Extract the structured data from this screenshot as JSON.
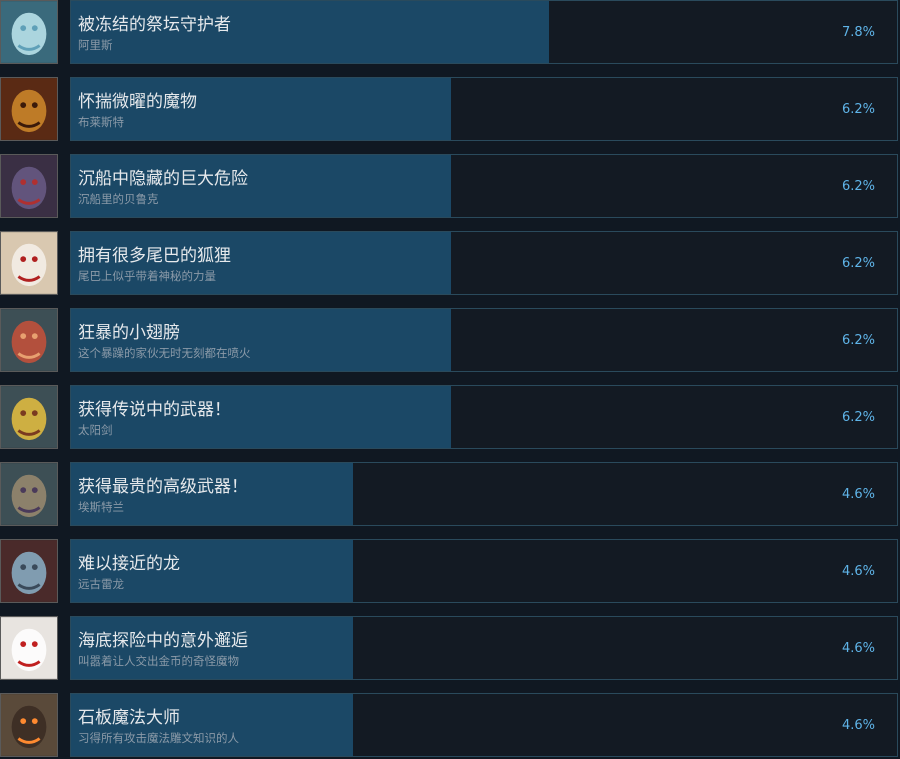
{
  "achievements": [
    {
      "title": "被冻结的祭坛守护者",
      "desc": "阿里斯",
      "percent": "7.8%",
      "fill": 0.078,
      "icon": "ice-golem-icon",
      "icon_bg": "#3a6a7c",
      "icon_fg": "#bfe8f0",
      "icon_accent": "#5fa0b8"
    },
    {
      "title": "怀揣微曜的魔物",
      "desc": "布莱斯特",
      "percent": "6.2%",
      "fill": 0.062,
      "icon": "armored-demon-icon",
      "icon_bg": "#5a2a14",
      "icon_fg": "#d08a2a",
      "icon_accent": "#3a1a0a"
    },
    {
      "title": "沉船中隐藏的巨大危险",
      "desc": "沉船里的贝鲁克",
      "percent": "6.2%",
      "fill": 0.062,
      "icon": "sunken-beast-icon",
      "icon_bg": "#3a2f44",
      "icon_fg": "#6a5a86",
      "icon_accent": "#b03030"
    },
    {
      "title": "拥有很多尾巴的狐狸",
      "desc": "尾巴上似乎带着神秘的力量",
      "percent": "6.2%",
      "fill": 0.062,
      "icon": "nine-tail-fox-icon",
      "icon_bg": "#d9c8b0",
      "icon_fg": "#f4f0ea",
      "icon_accent": "#b02020"
    },
    {
      "title": "狂暴的小翅膀",
      "desc": "这个暴躁的家伙无时无刻都在喷火",
      "percent": "6.2%",
      "fill": 0.062,
      "icon": "red-dragon-icon",
      "icon_bg": "#3d4f55",
      "icon_fg": "#c8503a",
      "icon_accent": "#e8a070"
    },
    {
      "title": "获得传说中的武器！",
      "desc": "太阳剑",
      "percent": "6.2%",
      "fill": 0.062,
      "icon": "sun-sword-icon",
      "icon_bg": "#3d4f55",
      "icon_fg": "#e8c040",
      "icon_accent": "#7a3a20"
    },
    {
      "title": "获得最贵的高级武器！",
      "desc": "埃斯特兰",
      "percent": "4.6%",
      "fill": 0.046,
      "icon": "scythe-icon",
      "icon_bg": "#3d4f55",
      "icon_fg": "#9a8a70",
      "icon_accent": "#4a3a5a"
    },
    {
      "title": "难以接近的龙",
      "desc": "远古雷龙",
      "percent": "4.6%",
      "fill": 0.046,
      "icon": "thunder-dragon-icon",
      "icon_bg": "#4a2a2a",
      "icon_fg": "#8ab0c8",
      "icon_accent": "#3a4a5a"
    },
    {
      "title": "海底探险中的意外邂逅",
      "desc": "叫嚣着让人交出金币的奇怪魔物",
      "percent": "4.6%",
      "fill": 0.046,
      "icon": "rabbit-monster-icon",
      "icon_bg": "#e8e4e0",
      "icon_fg": "#ffffff",
      "icon_accent": "#c02020"
    },
    {
      "title": "石板魔法大师",
      "desc": "习得所有攻击魔法雕文知识的人",
      "percent": "4.6%",
      "fill": 0.046,
      "icon": "rune-tablet-icon",
      "icon_bg": "#5a4a3a",
      "icon_fg": "#3a2a22",
      "icon_accent": "#ff8a30"
    }
  ]
}
